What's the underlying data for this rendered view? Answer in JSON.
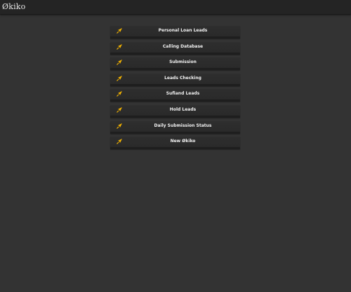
{
  "header": {
    "brand": "Økiko"
  },
  "colors": {
    "background": "#333333",
    "topbar": "#242424",
    "accent": "#f5b400"
  },
  "menu": {
    "items": [
      {
        "label": "Personal Loan Leads",
        "icon": "rocket-icon"
      },
      {
        "label": "Calling Database",
        "icon": "rocket-icon"
      },
      {
        "label": "Submission",
        "icon": "rocket-icon"
      },
      {
        "label": "Leads Checking",
        "icon": "rocket-icon"
      },
      {
        "label": "Sufiand Leads",
        "icon": "rocket-icon"
      },
      {
        "label": "Hold Leads",
        "icon": "rocket-icon"
      },
      {
        "label": "Daily Submission Status",
        "icon": "rocket-icon"
      },
      {
        "label": "New Økiko",
        "icon": "rocket-icon"
      }
    ]
  }
}
